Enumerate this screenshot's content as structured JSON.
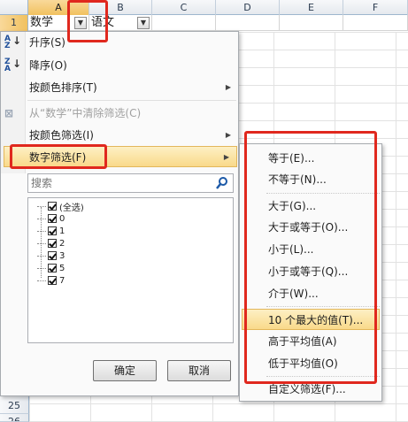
{
  "sheet": {
    "columns": [
      "A",
      "B",
      "C",
      "D",
      "E",
      "F"
    ],
    "row1_number": "1",
    "cell_a1": "数学",
    "cell_b1": "语文",
    "bottom_row_numbers": [
      "25",
      "26"
    ]
  },
  "menu": {
    "sort_asc": "升序(S)",
    "sort_desc": "降序(O)",
    "sort_by_color": "按颜色排序(T)",
    "clear_filter": "从“数学”中清除筛选(C)",
    "filter_by_color": "按颜色筛选(I)",
    "number_filter": "数字筛选(F)",
    "search_placeholder": "搜索",
    "list_items": [
      "(全选)",
      "0",
      "1",
      "2",
      "3",
      "5",
      "7"
    ],
    "ok": "确定",
    "cancel": "取消"
  },
  "submenu": {
    "items": [
      "等于(E)...",
      "不等于(N)...",
      "大于(G)...",
      "大于或等于(O)...",
      "小于(L)...",
      "小于或等于(Q)...",
      "介于(W)...",
      "10 个最大的值(T)...",
      "高于平均值(A)",
      "低于平均值(O)",
      "自定义筛选(F)..."
    ]
  },
  "colors": {
    "highlight": "#f9d98a",
    "annotation_red": "#e0281e",
    "header_blue": "#9eb6ce"
  }
}
